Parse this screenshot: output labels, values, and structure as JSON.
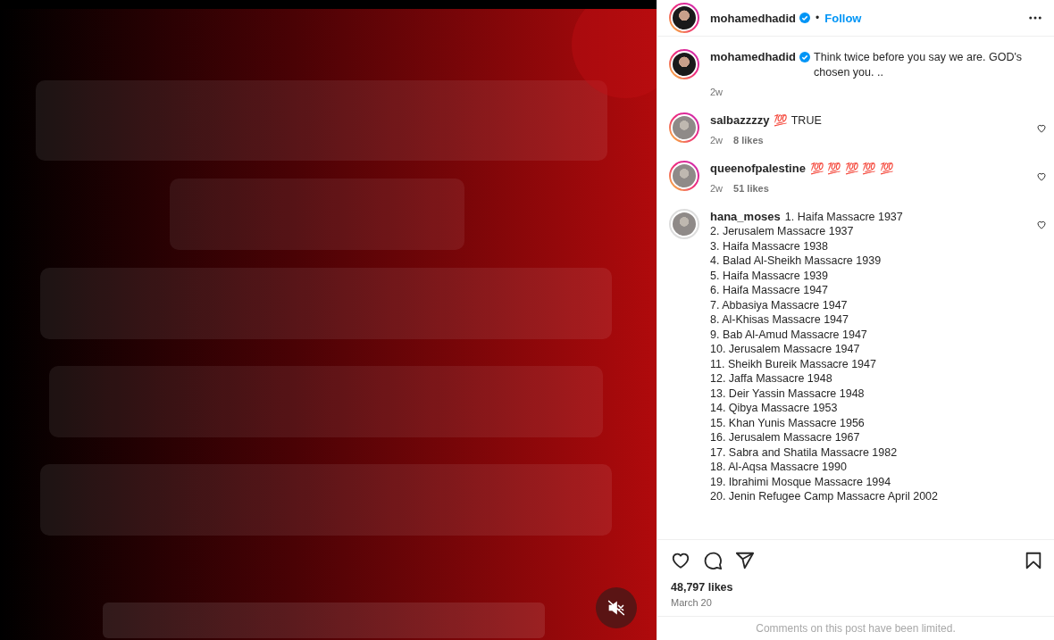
{
  "media": {
    "kind": "picture",
    "muted": true
  },
  "header": {
    "username": "mohamedhadid",
    "verified": true,
    "separator": "•",
    "follow": "Follow",
    "story_ring": true
  },
  "caption": {
    "username": "mohamedhadid",
    "verified": true,
    "text": "Think twice before you say we are. GOD's chosen you. ..",
    "time": "2w",
    "story_ring": true
  },
  "comments": [
    {
      "username": "salbazzzzy",
      "lines": [
        "💯 TRUE"
      ],
      "time": "2w",
      "likes": "8 likes",
      "story_ring": true
    },
    {
      "username": "queenofpalestine",
      "lines": [
        "💯 💯 💯 💯 💯"
      ],
      "time": "2w",
      "likes": "51 likes",
      "story_ring": true
    },
    {
      "username": "hana_moses",
      "lines": [
        "1. Haifa Massacre 1937",
        "2. Jerusalem Massacre 1937",
        "3. Haifa Massacre 1938",
        "4. Balad Al-Sheikh Massacre 1939",
        "5. Haifa Massacre 1939",
        "6. Haifa Massacre 1947",
        "7. Abbasiya Massacre 1947",
        "8. Al-Khisas Massacre 1947",
        "9. Bab Al-Amud Massacre 1947",
        "10. Jerusalem Massacre 1947",
        "11. Sheikh Bureik Massacre 1947",
        "12. Jaffa Massacre 1948",
        "13. Deir Yassin Massacre 1948",
        "14. Qibya Massacre 1953",
        "15. Khan Yunis Massacre 1956",
        "16. Jerusalem Massacre 1967",
        "17. Sabra and Shatila Massacre 1982",
        "18. Al-Aqsa Massacre 1990",
        "19. Ibrahimi Mosque Massacre 1994",
        "20. Jenin Refugee Camp Massacre April 2002"
      ],
      "story_ring": false
    }
  ],
  "likes": "48,797 likes",
  "date": "March 20",
  "notice": "Comments on this post have been limited."
}
